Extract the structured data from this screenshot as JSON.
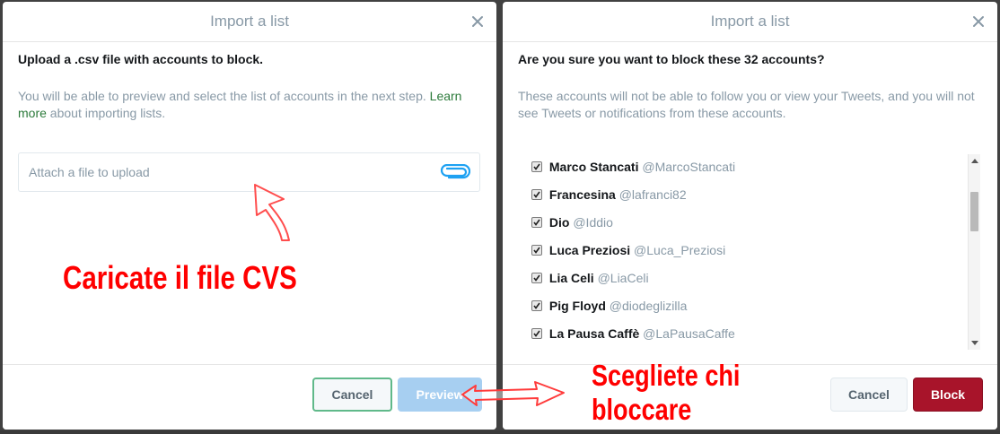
{
  "left_modal": {
    "title": "Import a list",
    "heading": "Upload a .csv file with accounts to block.",
    "description_pre": "You will be able to preview and select the list of accounts in the next step. ",
    "learn_more": "Learn more",
    "description_post": " about importing lists.",
    "upload_placeholder": "Attach a file to upload",
    "cancel_label": "Cancel",
    "preview_label": "Preview"
  },
  "right_modal": {
    "title": "Import a list",
    "heading": "Are you sure you want to block these 32 accounts?",
    "description": "These accounts will not be able to follow you or view your Tweets, and you will not see Tweets or notifications from these accounts.",
    "accounts": [
      {
        "name": "Marco Stancati",
        "handle": "@MarcoStancati",
        "checked": true
      },
      {
        "name": "Francesina",
        "handle": "@lafranci82",
        "checked": true
      },
      {
        "name": "Dio",
        "handle": "@Iddio",
        "checked": true
      },
      {
        "name": "Luca Preziosi",
        "handle": "@Luca_Preziosi",
        "checked": true
      },
      {
        "name": "Lia Celi",
        "handle": "@LiaCeli",
        "checked": true
      },
      {
        "name": "Pig Floyd",
        "handle": "@diodeglizilla",
        "checked": true
      },
      {
        "name": "La Pausa Caffè",
        "handle": "@LaPausaCaffe",
        "checked": true
      }
    ],
    "cancel_label": "Cancel",
    "block_label": "Block"
  },
  "annotations": {
    "left_text": "Caricate il file CVS",
    "right_text": "Scegliete chi\nbloccare",
    "color": "#ff0000"
  },
  "icons": {
    "close": "close-icon",
    "attach": "paperclip-icon",
    "checkbox": "checkbox-checked-icon"
  }
}
